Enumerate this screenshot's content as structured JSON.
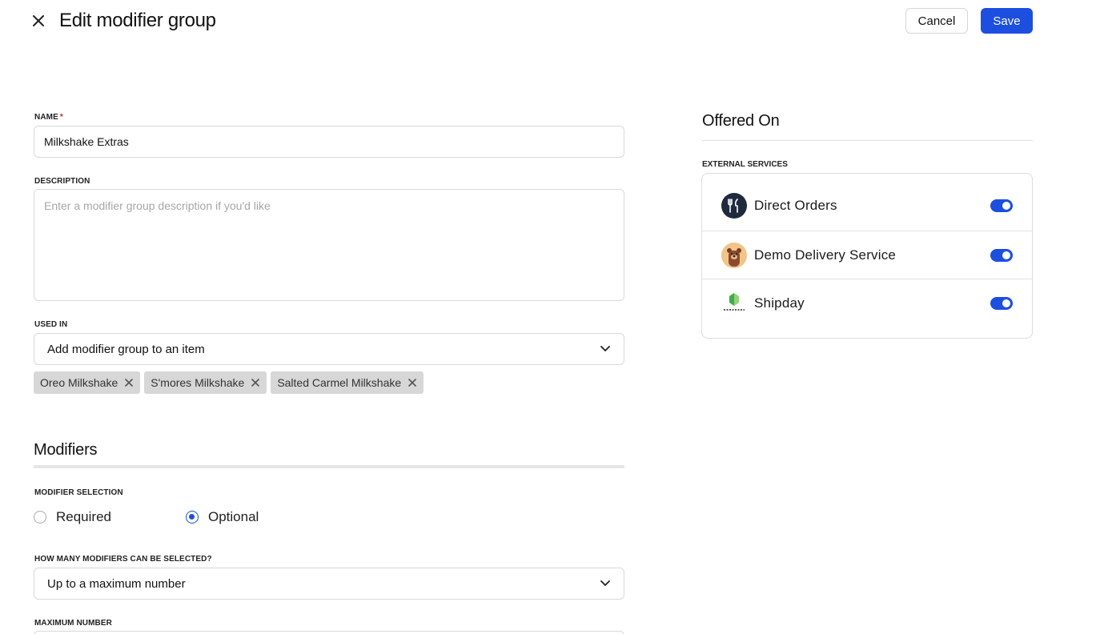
{
  "header": {
    "title": "Edit modifier group",
    "cancel_label": "Cancel",
    "save_label": "Save"
  },
  "form": {
    "name": {
      "label": "NAME",
      "required_mark": "*",
      "value": "Milkshake Extras"
    },
    "description": {
      "label": "DESCRIPTION",
      "placeholder": "Enter a modifier group description if you'd like",
      "value": ""
    },
    "used_in": {
      "label": "USED IN",
      "selected": "Add modifier group to an item",
      "chips": [
        "Oreo Milkshake",
        "S'mores Milkshake",
        "Salted Carmel Milkshake"
      ]
    }
  },
  "modifiers": {
    "title": "Modifiers",
    "selection_label": "MODIFIER SELECTION",
    "options": [
      {
        "label": "Required",
        "checked": false
      },
      {
        "label": "Optional",
        "checked": true
      }
    ],
    "how_many_label": "HOW MANY MODIFIERS CAN BE SELECTED?",
    "how_many_value": "Up to a maximum number",
    "maximum_label": "MAXIMUM NUMBER"
  },
  "offered_on": {
    "title": "Offered On",
    "external_label": "EXTERNAL SERVICES",
    "services": [
      {
        "name": "Direct Orders",
        "icon": "fork-knife-icon",
        "enabled": true
      },
      {
        "name": "Demo Delivery Service",
        "icon": "bear-avatar-icon",
        "enabled": true
      },
      {
        "name": "Shipday",
        "icon": "shipday-logo-icon",
        "enabled": true
      }
    ]
  },
  "colors": {
    "accent": "#1c4fe0",
    "chip_bg": "#d7d7d7",
    "required": "#d0202a"
  }
}
